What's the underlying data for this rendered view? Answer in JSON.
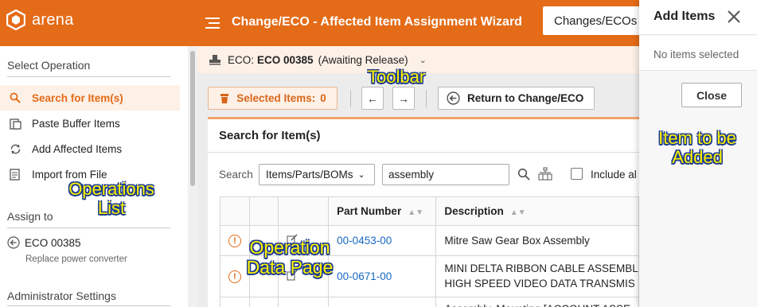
{
  "header": {
    "logo_text": "arena",
    "title": "Change/ECO - Affected Item Assignment Wizard",
    "nav_dropdown": "Changes/ECOs"
  },
  "sidebar": {
    "select_operation_heading": "Select Operation",
    "operations": [
      {
        "label": "Search for Item(s)",
        "icon": "search-icon",
        "active": true
      },
      {
        "label": "Paste Buffer Items",
        "icon": "paste-icon",
        "active": false
      },
      {
        "label": "Add Affected Items",
        "icon": "refresh-icon",
        "active": false
      },
      {
        "label": "Import from File",
        "icon": "import-file-icon",
        "active": false
      }
    ],
    "assign_to_heading": "Assign to",
    "assign_eco": "ECO 00385",
    "assign_eco_desc": "Replace power converter",
    "admin_heading": "Administrator Settings"
  },
  "eco_bar": {
    "prefix": "ECO:",
    "eco_number": "ECO 00385",
    "status": "(Awaiting Release)"
  },
  "toolbar": {
    "selected_items_label": "Selected Items:",
    "selected_items_count": "0",
    "back_icon": "arrow-left-icon",
    "forward_icon": "arrow-right-icon",
    "return_label": "Return to Change/ECO"
  },
  "search_panel": {
    "title": "Search for Item(s)",
    "search_label": "Search",
    "scope_selected": "Items/Parts/BOMs",
    "query_value": "assembly",
    "include_label": "Include al"
  },
  "table": {
    "columns": [
      "",
      "",
      "",
      "Part Number",
      "Description"
    ],
    "rows": [
      {
        "part_number": "00-0453-00",
        "description": "Mitre Saw Gear Box Assembly"
      },
      {
        "part_number": "00-0671-00",
        "description": "MINI DELTA RIBBON CABLE ASSEMBL HIGH SPEED VIDEO DATA TRANSMIS"
      },
      {
        "part_number": "",
        "description": "Assembly, Mounting [ACCOUNT ASSE"
      }
    ]
  },
  "drawer": {
    "title": "Add Items",
    "empty_text": "No items selected",
    "close_label": "Close"
  },
  "annotations": {
    "toolbar": "Toolbar",
    "operations_list": "Operations\nList",
    "operation_data_page": "Operation\nData Page",
    "item_to_be_added": "Item to be\nAdded"
  },
  "colors": {
    "brand_orange": "#e46b17",
    "link_blue": "#1769c2",
    "annotation_yellow": "#fff200"
  }
}
